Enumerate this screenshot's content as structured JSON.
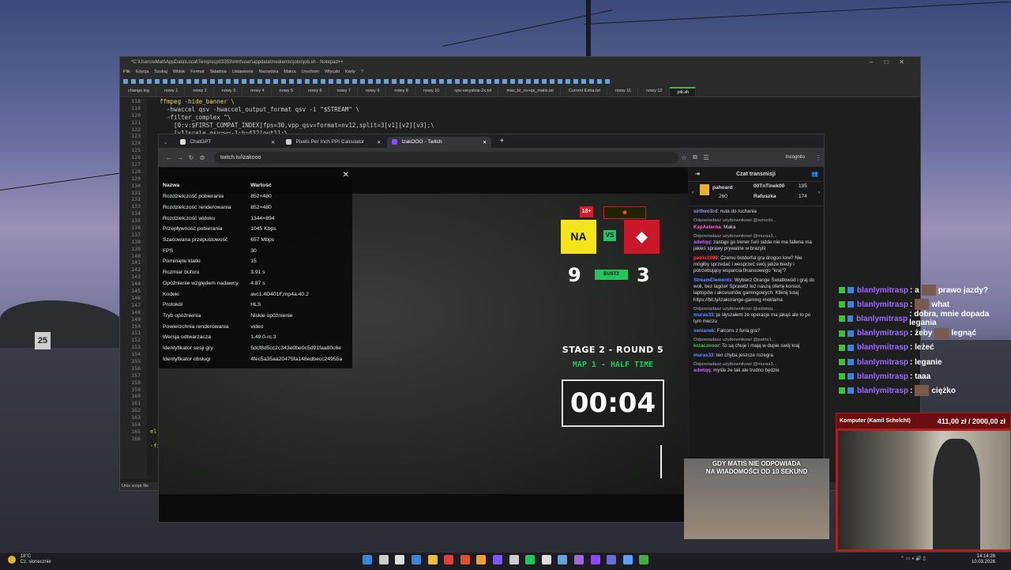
{
  "notepad": {
    "title": "*C:\\Users\\eMatt\\AppData\\Local\\Temp\\scp03353\\mnt\\user\\appdata\\mediamtx\\jobs\\job.sh - Notepad++",
    "menu": [
      "Plik",
      "Edycja",
      "Szukaj",
      "Widok",
      "Format",
      "Składnia",
      "Ustawienia",
      "Narzędzia",
      "Makra",
      "Uruchom",
      "Wtyczki",
      "Karty",
      "?"
    ],
    "tabs": [
      "change.log",
      "nowy 1",
      "nowy 2",
      "nowy 3",
      "nowy 4",
      "nowy 5",
      "nowy 6",
      "nowy 7",
      "nowy 9",
      "nowy 8",
      "nowy 10",
      "cpu-veryslow-2x.txt",
      "max_bt_nv+qs_matis.txt",
      "Current Estra.txt",
      "nowy 11",
      "nowy 12",
      "job.sh"
    ],
    "line_numbers": [
      "118",
      "119",
      "120",
      "121",
      "122",
      "123",
      "124",
      "125",
      "126",
      "127",
      "128",
      "129",
      "130",
      "131",
      "132",
      "133",
      "134",
      "135",
      "136",
      "137",
      "138",
      "139",
      "140",
      "141",
      "142",
      "143",
      "144",
      "145",
      "146",
      "147",
      "148",
      "149",
      "150",
      "151",
      "152",
      "153",
      "154",
      "155",
      "156",
      "157",
      "158",
      "159",
      "160",
      "161",
      "162",
      "163",
      "164",
      "165",
      "166"
    ],
    "code_1": "ffmpeg -hide_banner \\",
    "code_2": "  -hwaccel qsv -hwaccel_output_format qsv -i \"$STREAM\" \\",
    "code_3": "  -filter_complex \"\\",
    "code_4": "    [0:v:$FIRST_COMPAT_INDEX]fps=30,vpp_qsv=format=nv12,split=3[v1][v2][v3];\\",
    "code_5": "    [v1]scale_qsv=w=-1:h=432[out1];\\",
    "code_el": "el",
    "code_fi": "-fi",
    "status": "Unix script file"
  },
  "browser": {
    "tabs": [
      {
        "label": "ChatGPT",
        "color": "#dddddd"
      },
      {
        "label": "Pixels Per Inch PPI Calculator",
        "color": "#cccccc"
      },
      {
        "label": "IzakOOO - Twitch",
        "color": "#9146ff"
      }
    ],
    "url": "twitch.tv/izakooo",
    "incognito": "Incognito"
  },
  "stats": {
    "col_name": "Nazwa",
    "col_value": "Wartość",
    "rows": [
      [
        "Rozdzielczość pobierania",
        "852×480"
      ],
      [
        "Rozdzielczość renderowania",
        "852×480"
      ],
      [
        "Rozdzielczość widoku",
        "1344×894"
      ],
      [
        "Przepływność pobierania",
        "1045 Kbps"
      ],
      [
        "Szacowana przepustowość",
        "657 Mbps"
      ],
      [
        "FPS",
        "30"
      ],
      [
        "Pominięte klatki",
        "15"
      ],
      [
        "Rozmiar buforu",
        "3.91 s"
      ],
      [
        "Opóźnienie względem nadawcy",
        "4.87 s"
      ],
      [
        "Kodeki",
        "avc1.4D401F,mp4a.40.2"
      ],
      [
        "Protokół",
        "HLS"
      ],
      [
        "Tryb opóźnienia",
        "Niskie opóźnienie"
      ],
      [
        "Powierzchnia renderowania",
        "video"
      ],
      [
        "Wersja odtwarzacza",
        "1.49.0-rc.3"
      ],
      [
        "Identyfikator sesji gry",
        "5dcf8d5cc2c343e0be0c5d91faa80c6e"
      ],
      [
        "Identyfikator obsługi",
        "4fec5a35aa20475fa148edbecc24955a"
      ]
    ]
  },
  "scoreboard": {
    "age": "18+",
    "vs": "VS",
    "score_a": "9",
    "score_b": "3",
    "best_of": "BUST2",
    "stage": "STAGE 2 - ROUND 5",
    "map": "MAP 1 - HALF TIME",
    "timer": "00:04"
  },
  "chat": {
    "title": "Czat transmisji",
    "gift_user1": "pahoard",
    "gift_count1": "260",
    "gift_user2": "00TnTinek00",
    "gift_count2": "195",
    "gift_user3": "Rafuszka",
    "gift_count3": "174",
    "messages": [
      {
        "user": "sirtheo3rd",
        "color": "#9a9ad8",
        "text": ": nuta do ruchania",
        "reply": ""
      },
      {
        "user": "KspAeterna",
        "color": "#ff66cc",
        "text": ": Maka",
        "reply": "Odpowiadasz użytkownikowi @sznorbi..."
      },
      {
        "user": "adwtqq",
        "color": "#c066ff",
        "text": ": zastąpi go trener furii sidde nie ma fallena ma jakieś sprawy prywatne w brazylii",
        "reply": "Odpowiadasz użytkownikowi @muras3..."
      },
      {
        "user": "patris1999",
        "color": "#ff4040",
        "text": ": Czemu botderful gra drogon lore? Nie mógłby sprzedać i wesprzeć swój jakże biedy i potrzebujący wsparcia finansowego \"kraj\"?",
        "reply": ""
      },
      {
        "user": "StreamElements",
        "color": "#6a8cff",
        "text": ": Wybierz Orange Światłowód i graj do woli, bez lagów! Sprawdź też naszą ofertę konsol, laptopów i akcesoriów gamingowych. Kliknij tutaj https://bit.ly/izakorange-gaming #reklama",
        "reply": ""
      },
      {
        "user": "muras33",
        "color": "#6a8cff",
        "text": ": ja słyszałem że operacje ma jakąś ale to po tym meczu",
        "reply": "Odpowiadasz użytkownikowi @adwtqq..."
      },
      {
        "user": "senianek",
        "color": "#6a8cff",
        "text": ": Falcons z furia gra?",
        "reply": ""
      },
      {
        "user": "krzaczooor",
        "color": "#44cc44",
        "text": ": To są chuje i mają w dupie swój kraj",
        "reply": "Odpowiadasz użytkownikowi @patris1..."
      },
      {
        "user": "muras33",
        "color": "#6a8cff",
        "text": ": ten chyba jeszcze rozegra",
        "reply": ""
      },
      {
        "user": "adwtqq",
        "color": "#c066ff",
        "text": ": myśle że tak ale trudno będzie",
        "reply": "Odpowiadasz użytkownikowi @muras3..."
      }
    ]
  },
  "overlay_popup": {
    "line1": "GDY MATIS NIE ODPOWIADA",
    "line2": "NA WIADOMOŚCI OD 10 SEKUND"
  },
  "desktop_chat": [
    {
      "user": "blanlymitrasp",
      "text": ": a",
      "emote_text": "prawo jazdy?"
    },
    {
      "user": "blanlymitrasp",
      "text": ":",
      "emote_text": "what"
    },
    {
      "user": "blanlymitrasp",
      "text": ": dobra, mnie dopada legania",
      "emote_text": ""
    },
    {
      "user": "blanlymitrasp",
      "text": ": żeby",
      "emote_text": "legnąć"
    },
    {
      "user": "blanlymitrasp",
      "text": ": leżeć",
      "emote_text": ""
    },
    {
      "user": "blanlymitrasp",
      "text": ": leganie",
      "emote_text": ""
    },
    {
      "user": "blanlymitrasp",
      "text": ": taaa",
      "emote_text": ""
    },
    {
      "user": "blanlymitrasp",
      "text": ":",
      "emote_text": "ciężko"
    }
  ],
  "donation": {
    "name": "Komputer (Kamil Schelcht)",
    "amount": "411,00 zł / 2000,00 zł"
  },
  "taskbar": {
    "temp": "18°C",
    "weather": "Cz. słonecznie",
    "time": "14:14:26",
    "date": "10.03.2026",
    "icon_colors": [
      "#3a86d8",
      "#cccccc",
      "#dddddd",
      "#3a86d8",
      "#e8c040",
      "#e04040",
      "#e05030",
      "#f0a030",
      "#7a5af0",
      "#cccccc",
      "#22c55e",
      "#dddddd",
      "#6aa0d8",
      "#a06ad8",
      "#9146ff",
      "#6a6ad8",
      "#5aa0ff",
      "#44aa44"
    ]
  },
  "desktop_sign": "25"
}
